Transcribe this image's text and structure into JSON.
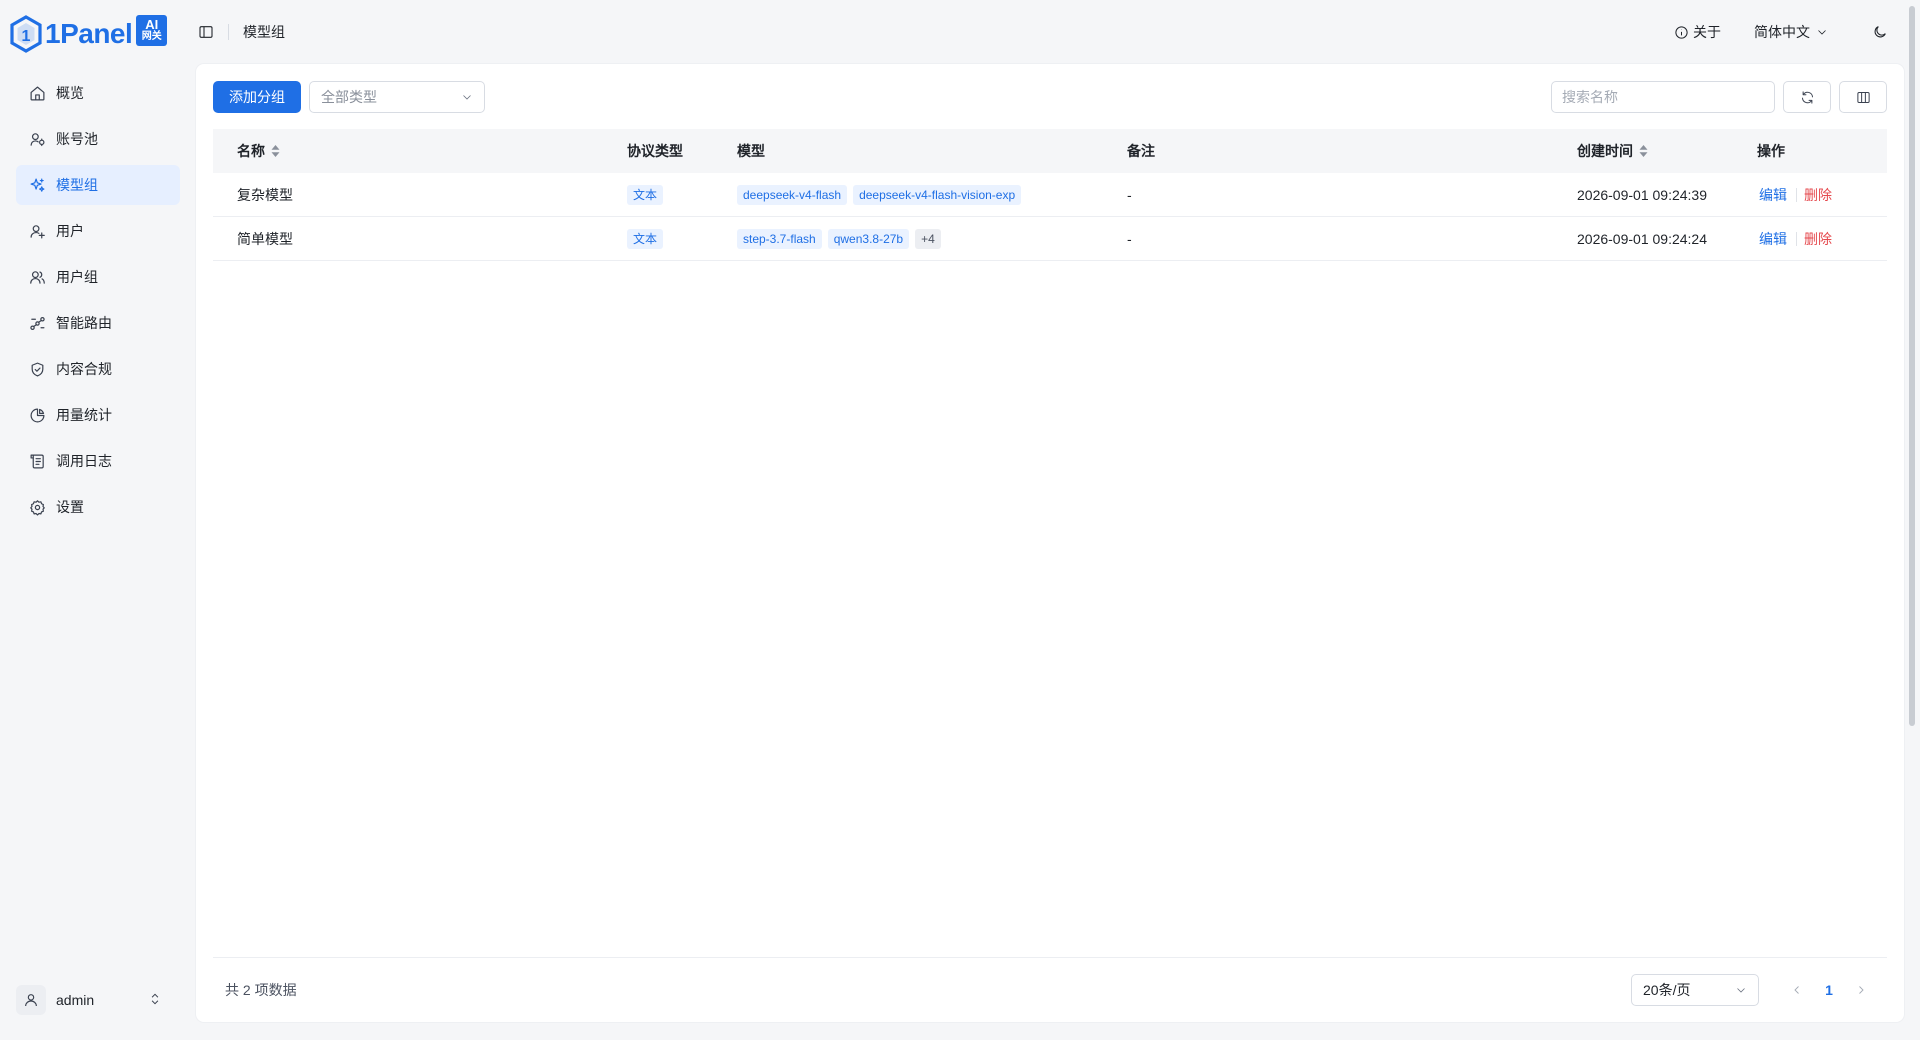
{
  "brand": {
    "name": "1Panel",
    "badge_top": "AI",
    "badge_bottom": "网关",
    "color": "#1f6fe5"
  },
  "sidebar": {
    "items": [
      {
        "label": "概览",
        "icon": "home-icon",
        "active": false
      },
      {
        "label": "账号池",
        "icon": "account-pool-icon",
        "active": false
      },
      {
        "label": "模型组",
        "icon": "sparkle-icon",
        "active": true
      },
      {
        "label": "用户",
        "icon": "user-add-icon",
        "active": false
      },
      {
        "label": "用户组",
        "icon": "users-icon",
        "active": false
      },
      {
        "label": "智能路由",
        "icon": "route-icon",
        "active": false
      },
      {
        "label": "内容合规",
        "icon": "shield-icon",
        "active": false
      },
      {
        "label": "用量统计",
        "icon": "pie-chart-icon",
        "active": false
      },
      {
        "label": "调用日志",
        "icon": "log-icon",
        "active": false
      },
      {
        "label": "设置",
        "icon": "gear-icon",
        "active": false
      }
    ],
    "user": {
      "name": "admin"
    }
  },
  "header": {
    "breadcrumb": "模型组",
    "about": "关于",
    "language": "简体中文"
  },
  "toolbar": {
    "add_label": "添加分组",
    "type_filter": "全部类型",
    "search_placeholder": "搜索名称"
  },
  "table": {
    "columns": {
      "name": "名称",
      "protocol": "协议类型",
      "models": "模型",
      "note": "备注",
      "created": "创建时间",
      "ops": "操作"
    },
    "rows": [
      {
        "name": "复杂模型",
        "protocol": "文本",
        "models": [
          "deepseek-v4-flash",
          "deepseek-v4-flash-vision-exp"
        ],
        "more": "",
        "note": "-",
        "created": "2026-09-01 09:24:39",
        "edit": "编辑",
        "delete": "删除"
      },
      {
        "name": "简单模型",
        "protocol": "文本",
        "models": [
          "step-3.7-flash",
          "qwen3.8-27b"
        ],
        "more": "+4",
        "note": "-",
        "created": "2026-09-01 09:24:24",
        "edit": "编辑",
        "delete": "删除"
      }
    ]
  },
  "footer": {
    "total": "共 2 项数据",
    "page_size": "20条/页",
    "current_page": "1"
  }
}
